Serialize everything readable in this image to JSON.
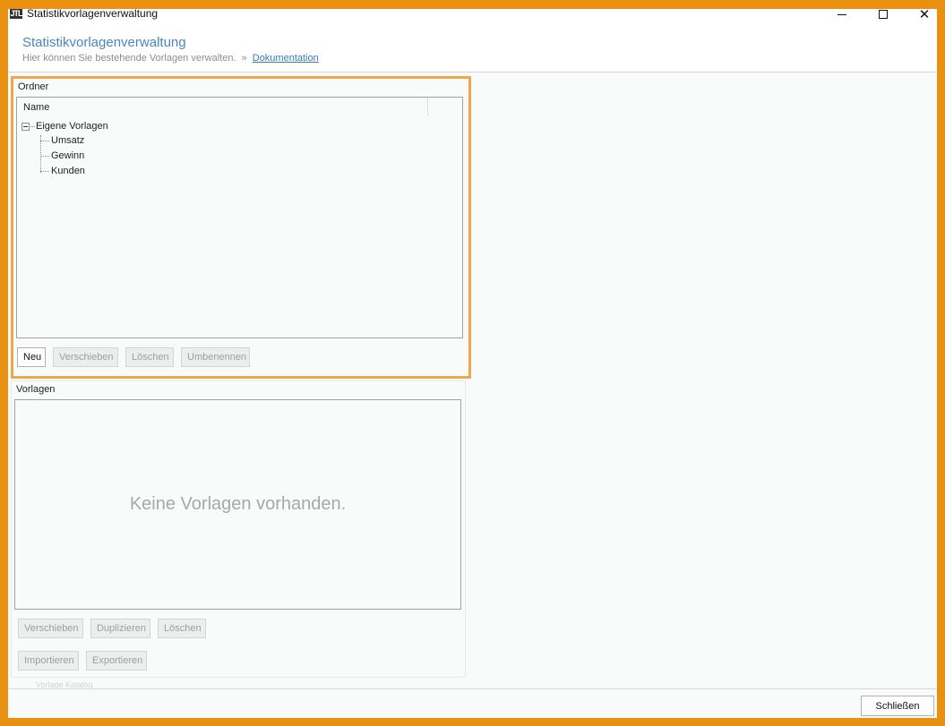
{
  "window": {
    "title": "Statistikvorlagenverwaltung",
    "app_icon": "JTL",
    "controls": {
      "minimize_icon": "minimize-icon",
      "maximize_icon": "maximize-icon",
      "close_icon": "close-icon"
    }
  },
  "header": {
    "title": "Statistikvorlagenverwaltung",
    "subtitle": "Hier können Sie bestehende Vorlagen verwalten.",
    "separator": "»",
    "doc_link": "Dokumentation"
  },
  "ordner": {
    "label": "Ordner",
    "column_header": "Name",
    "root": "Eigene Vorlagen",
    "children": [
      "Umsatz",
      "Gewinn",
      "Kunden"
    ],
    "buttons": {
      "new": "Neu",
      "move": "Verschieben",
      "delete": "Löschen",
      "rename": "Umbenennen"
    }
  },
  "vorlagen": {
    "label": "Vorlagen",
    "empty_message": "Keine Vorlagen vorhanden.",
    "buttons": {
      "move": "Verschieben",
      "duplicate": "Duplizieren",
      "delete": "Löschen",
      "import": "Importieren",
      "export": "Exportieren"
    },
    "catalog_link": "Vorlage Katalog"
  },
  "footer": {
    "close": "Schließen"
  },
  "colors": {
    "accent_frame": "#e8900f",
    "highlight": "#f0a64b",
    "title_blue": "#4a86c0"
  }
}
